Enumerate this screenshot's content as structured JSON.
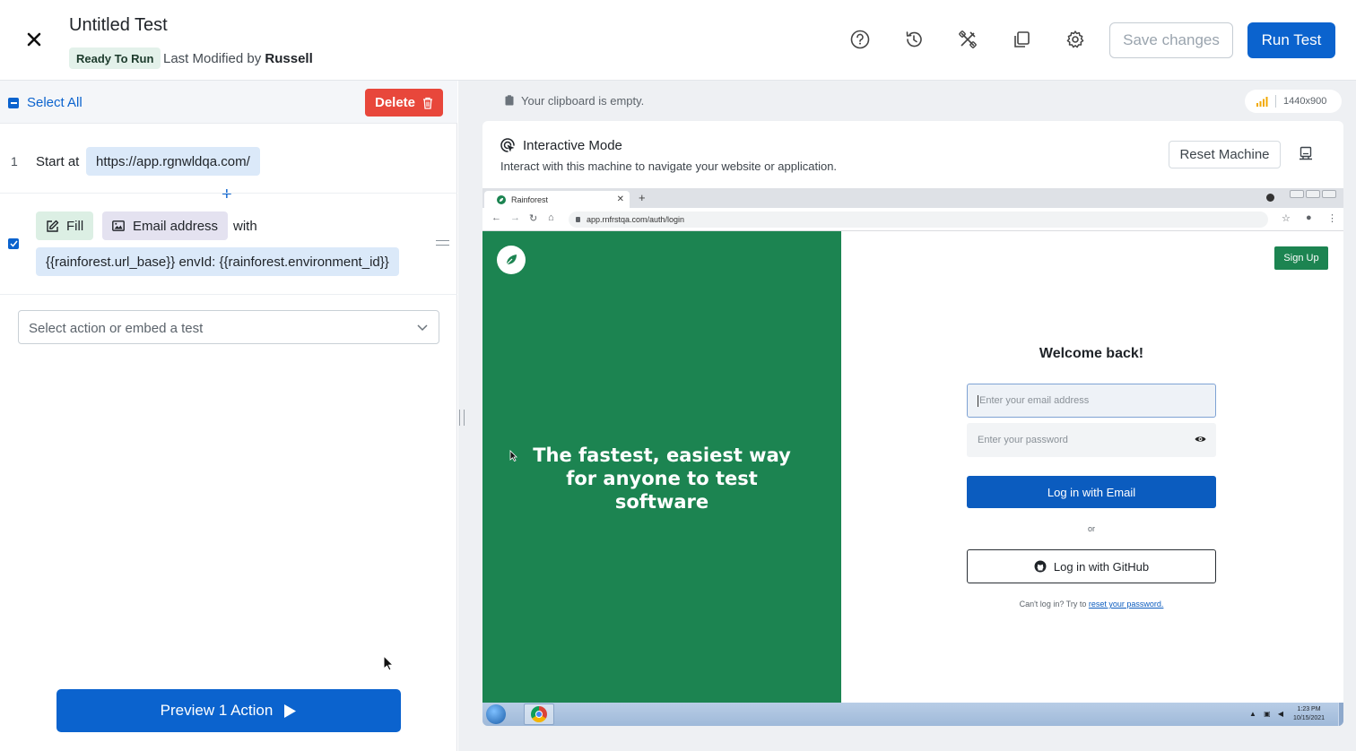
{
  "header": {
    "title": "Untitled Test",
    "status": "Ready To Run",
    "modified_prefix": "Last Modified by",
    "modified_by": "Russell",
    "save_label": "Save changes",
    "run_label": "Run Test",
    "icons": [
      "help-icon",
      "history-icon",
      "tools-icon",
      "copy-icon",
      "gear-icon"
    ]
  },
  "left": {
    "select_all": "Select All",
    "delete_label": "Delete",
    "steps": [
      {
        "number": "1",
        "prefix": "Start at",
        "url": "https://app.rgnwldqa.com/"
      },
      {
        "action": "Fill",
        "target": "Email address",
        "with": "with",
        "value": "{{rainforest.url_base}} envId: {{rainforest.environment_id}}"
      }
    ],
    "action_placeholder": "Select action or embed a test",
    "preview_label": "Preview 1 Action"
  },
  "right": {
    "clipboard": "Your clipboard is empty.",
    "resolution": "1440x900",
    "mode_title": "Interactive Mode",
    "mode_sub": "Interact with this machine to navigate your website or application.",
    "reset_label": "Reset Machine"
  },
  "browser": {
    "tab_title": "Rainforest",
    "url": "app.rnfrstqa.com/auth/login",
    "hero": "The fastest, easiest way for anyone to test software",
    "signup": "Sign Up",
    "welcome": "Welcome back!",
    "email_placeholder": "Enter your email address",
    "password_placeholder": "Enter your password",
    "login_email": "Log in with Email",
    "or": "or",
    "login_github": "Log in with GitHub",
    "cant_login": "Can't log in? Try to",
    "reset_link": "reset your password.",
    "clock_time": "1:23 PM",
    "clock_date": "10/15/2021"
  },
  "colors": {
    "primary": "#0b63ce",
    "danger": "#e8473b",
    "rainforest_green": "#1c8451"
  }
}
